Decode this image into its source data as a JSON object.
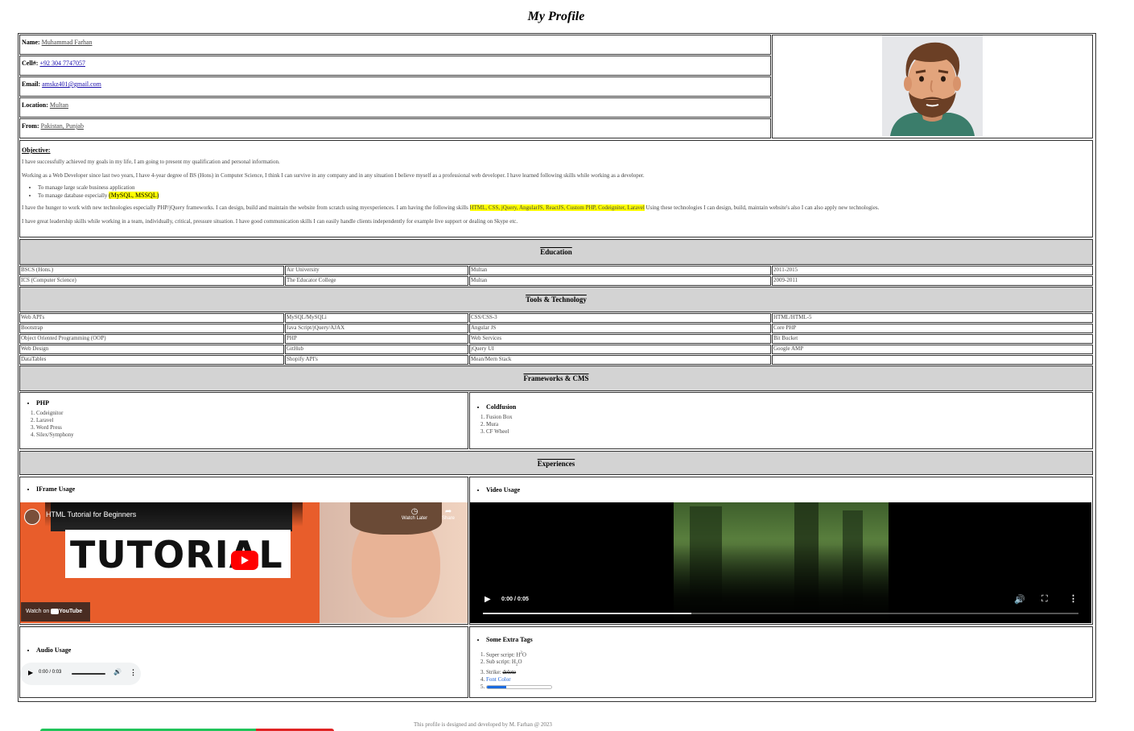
{
  "title": "My Profile",
  "info": {
    "name_label": "Name:",
    "name": "Muhammad Farhan",
    "cell_label": "Cell#:",
    "cell": "+92 304 7747057",
    "email_label": "Email:",
    "email": "amskz401@gmail.com",
    "location_label": "Location:",
    "location": "Multan",
    "from_label": "From:",
    "from": "Pakistan, Punjab"
  },
  "objective": {
    "heading": "Objective:",
    "p1": "I have successfully achieved my goals in my life, I am going to present my qualification and personal information.",
    "p2": "Working as a Web Developer since last two years, I have 4-year degree of BS (Hons) in Computer Science, I think I can survive in any company and in any situation I believe myself as a professional web developer. I have learned following skills while working as a developer.",
    "bullet1": "To manage large scale business application",
    "bullet2_pre": "To manage database especially ",
    "bullet2_hl": "(MySQL, MSSQL)",
    "p3_pre": "I have the hunger to work with new technologies especially PHP/jQuery frameworks. I can design, build and maintain the website from scratch using myexperiences. I am having the following skills ",
    "p3_hl": "HTML, CSS, jQuery, AngularJS, ReactJS, Custom PHP, Codeigniter, Laravel",
    "p3_post": " Using these technologies I can design, build, maintain website's also I can also apply new technologies.",
    "p4": "I have great leadership skills while working in a team, individually, critical, pressure situation. I have good communication skills I can easily handle clients independently for example live support or dealing on Skype etc."
  },
  "education": {
    "heading": "Education",
    "rows": [
      [
        "BSCS (Hons.)",
        "Air University",
        "Multan",
        "2011-2015"
      ],
      [
        "ICS (Computer Science)",
        "The Educator College",
        "Multan",
        "2009-2011"
      ]
    ]
  },
  "tools": {
    "heading": "Tools & Technology",
    "rows": [
      [
        "Web API's",
        "MySQL/MySQLi",
        "CSS/CSS-3",
        "HTML/HTML-5"
      ],
      [
        "Bootstrap",
        "Java Script/jQuery/AJAX",
        "Angular JS",
        "Core PHP"
      ],
      [
        "Object Oriented Programming (OOP)",
        "PHP",
        "Web Services",
        "Bit Bucket"
      ],
      [
        "Web Design",
        "GitHub",
        "jQuery UI",
        "Google AMP"
      ],
      [
        "DataTables",
        "Shopify API's",
        "Mean/Mern Stack",
        ""
      ]
    ]
  },
  "frameworks": {
    "heading": "Frameworks & CMS",
    "php_title": "PHP",
    "php_items": [
      "Codeignitor",
      "Laravel",
      "Word Press",
      "Silex/Symphony"
    ],
    "cf_title": "Coldfusion",
    "cf_items": [
      "Fusion Box",
      "Mura",
      "CF Wheel"
    ]
  },
  "experiences": {
    "heading": "Experiences",
    "iframe_title": "IFrame Usage",
    "video_title": "Video Usage",
    "audio_title": "Audio Usage",
    "extra_title": "Some Extra Tags",
    "yt_title": "HTML Tutorial for Beginners",
    "yt_watch_later": "Watch Later",
    "yt_share": "Share",
    "yt_big": "TUTORIAL",
    "yt_watch_on": "Watch on",
    "yt_brand": "YouTube",
    "video_time": "0:00 / 0:05",
    "audio_time": "0:00 / 0:03",
    "video_progress": 0.35,
    "extra": {
      "sup_label": "Super script: H",
      "sup_num": "2",
      "sup_tail": "O",
      "sub_label": "Sub script: H",
      "sub_num": "2",
      "sub_tail": "O",
      "strike_label": "Strike: ",
      "strike_text": "delete",
      "font_color": "Font Color",
      "progress": 0.3
    }
  },
  "footer": "This profile is designed and developed by M. Farhan @ 2023",
  "colors": {
    "section_bg": "#d3d3d3",
    "highlight": "#ffff00",
    "link_blue": "#1a0dab",
    "youtube_red": "#ff0000"
  }
}
